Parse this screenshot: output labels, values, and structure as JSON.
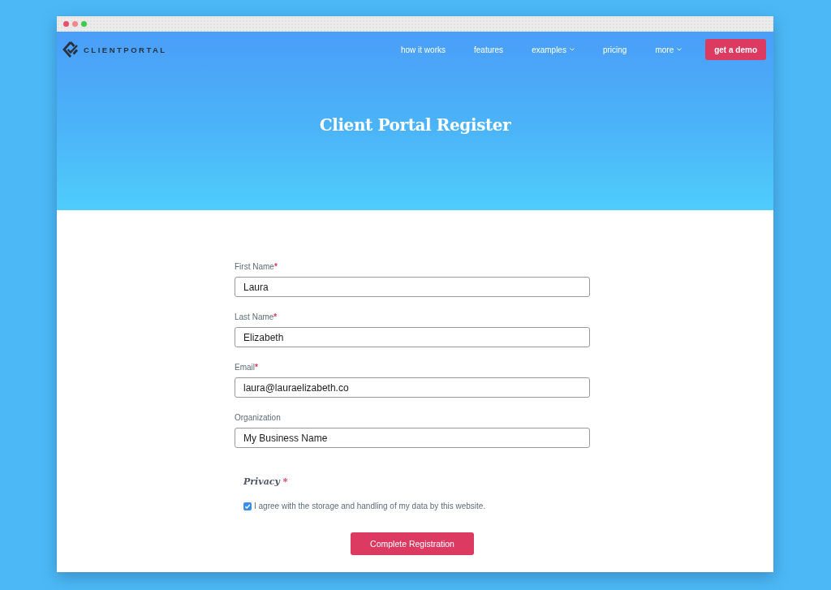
{
  "header": {
    "logo": {
      "text": "CLIENTPORTAL"
    },
    "nav": [
      {
        "label": "how it works",
        "has_menu": false
      },
      {
        "label": "features",
        "has_menu": false
      },
      {
        "label": "examples",
        "has_menu": true
      },
      {
        "label": "pricing",
        "has_menu": false
      },
      {
        "label": "more",
        "has_menu": true
      }
    ],
    "cta": "get a demo"
  },
  "hero": {
    "title": "Client Portal Register"
  },
  "form": {
    "fields": [
      {
        "label": "First Name",
        "required_mark": "*",
        "value": "Laura"
      },
      {
        "label": "Last Name",
        "required_mark": "*",
        "value": "Elizabeth"
      },
      {
        "label": "Email",
        "required_mark": "*",
        "value": "laura@lauraelizabeth.co"
      },
      {
        "label": "Organization",
        "value": "My Business Name"
      }
    ],
    "privacy": {
      "heading": "Privacy",
      "required_mark": "*",
      "consent": {
        "label": "I agree with the storage and handling of my data by this website.",
        "checked": true
      }
    },
    "submit": "Complete Registration"
  }
}
